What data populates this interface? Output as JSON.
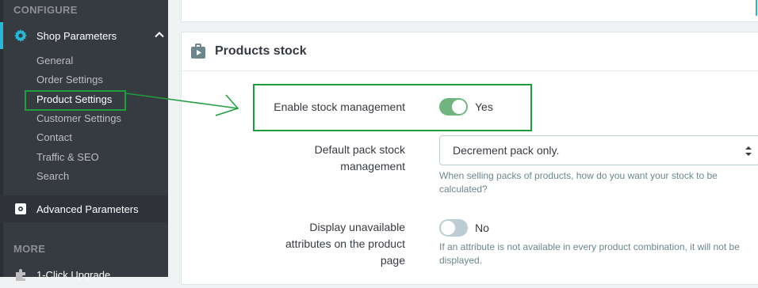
{
  "sidebar": {
    "section_configure": "CONFIGURE",
    "shop_parameters": "Shop Parameters",
    "sub_items": [
      "General",
      "Order Settings",
      "Product Settings",
      "Customer Settings",
      "Contact",
      "Traffic & SEO",
      "Search"
    ],
    "advanced_parameters": "Advanced Parameters",
    "section_more": "MORE",
    "one_click_upgrade": "1-Click Upgrade"
  },
  "panel": {
    "title": "Products stock",
    "icon": "products-stock-icon"
  },
  "form": {
    "enable_stock": {
      "label": "Enable stock management",
      "value": "Yes",
      "state": "on"
    },
    "pack_stock": {
      "label_line1": "Default pack stock",
      "label_line2": "management",
      "selected": "Decrement pack only.",
      "help": "When selling packs of products, how do you want your stock to be calculated?"
    },
    "unavailable_attrs": {
      "label_line1": "Display unavailable",
      "label_line2": "attributes on the product",
      "label_line3": "page",
      "value": "No",
      "state": "off",
      "help": "If an attribute is not available in every product combination, it will not be displayed."
    }
  },
  "colors": {
    "sidebar_bg": "#363a41",
    "accent": "#25b9d7",
    "toggle_on": "#70b580",
    "toggle_off": "#bbcdd2",
    "annotation": "#1e9d3e"
  }
}
